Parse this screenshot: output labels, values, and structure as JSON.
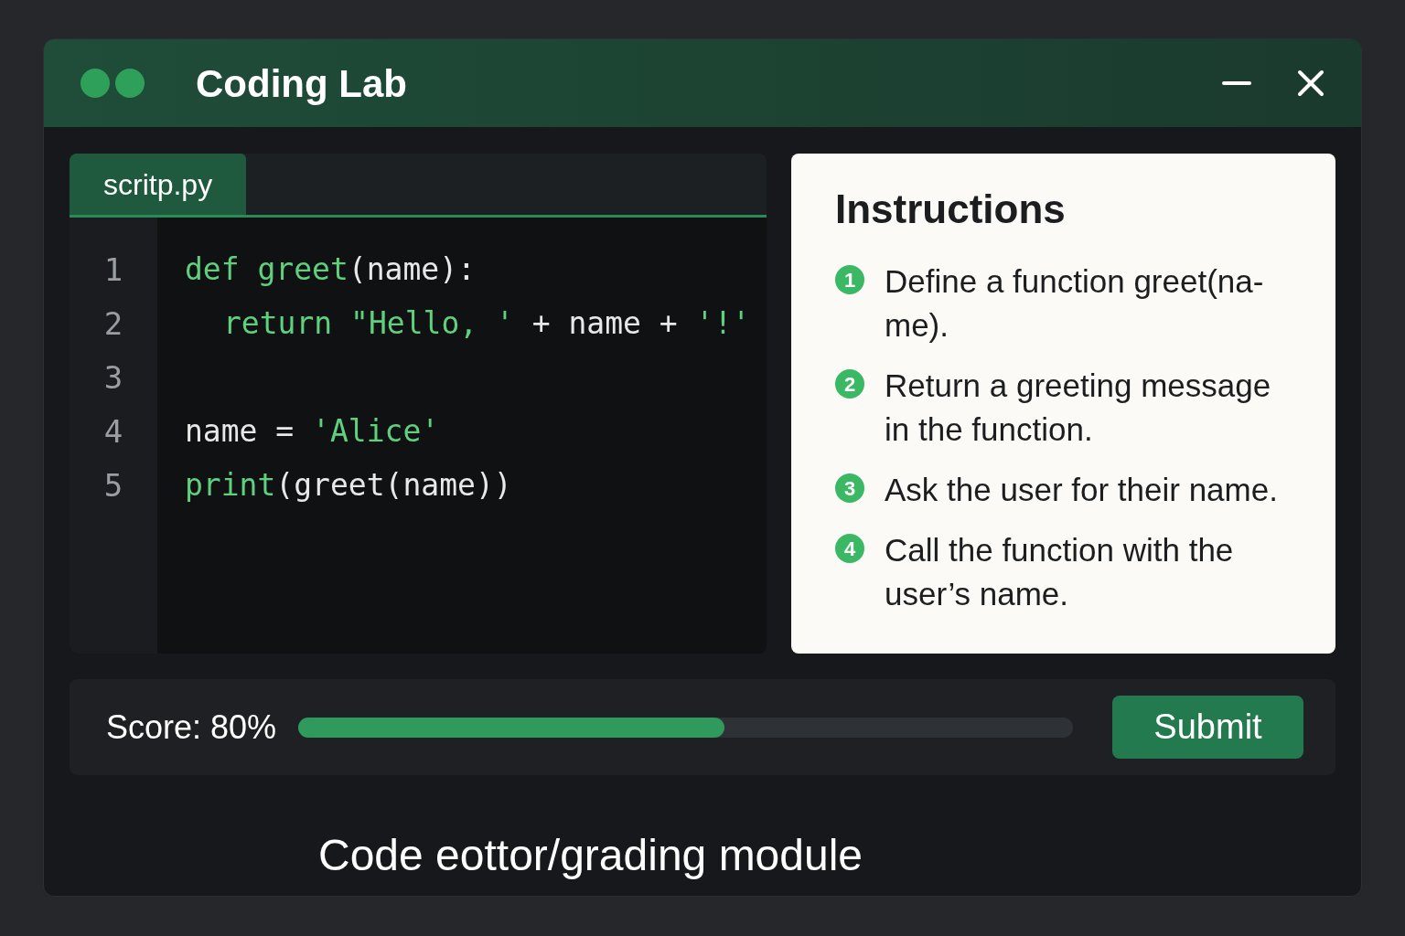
{
  "window": {
    "title": "Coding Lab"
  },
  "editor": {
    "tabs": [
      {
        "label": "scritp.py",
        "selected": true
      }
    ],
    "lines": [
      {
        "number": "1",
        "tokens": [
          {
            "kind": "keyword",
            "text": "def greet"
          },
          {
            "kind": "plain",
            "text": "(name):"
          }
        ]
      },
      {
        "number": "2",
        "indent": true,
        "tokens": [
          {
            "kind": "keyword",
            "text": "return \"Hello, '"
          },
          {
            "kind": "plain",
            "text": " + name + "
          },
          {
            "kind": "keyword",
            "text": "'!'"
          }
        ]
      },
      {
        "number": "3"
      },
      {
        "number": "4",
        "tokens": [
          {
            "kind": "plain",
            "text": "name = "
          },
          {
            "kind": "keyword",
            "text": "'Alice'"
          }
        ]
      },
      {
        "number": "5",
        "tokens": [
          {
            "kind": "keyword",
            "text": "print"
          },
          {
            "kind": "plain",
            "text": "(greet(name))"
          }
        ]
      }
    ]
  },
  "instructions": {
    "title": "Instructions",
    "steps": [
      {
        "number": "1",
        "text": "Define a function greet(na-me)."
      },
      {
        "number": "2",
        "text": "Return a greeting message in the function."
      },
      {
        "number": "3",
        "text": "Ask the user for their name."
      },
      {
        "number": "4",
        "text": "Call the function with the user’s name."
      }
    ]
  },
  "grading": {
    "score_label": "Score: 80%",
    "level": 0.55,
    "button": "Submit"
  },
  "caption": "Code eottor/grading module"
}
